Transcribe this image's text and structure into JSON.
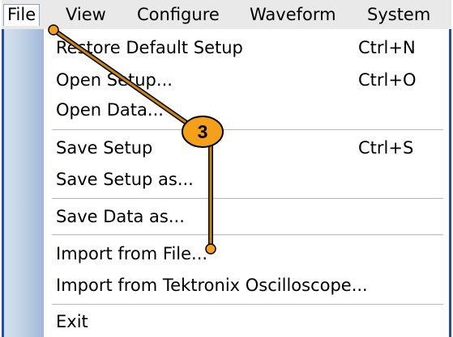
{
  "menubar": {
    "items": [
      "File",
      "View",
      "Configure",
      "Waveform",
      "System"
    ],
    "active_index": 0
  },
  "file_menu": {
    "items": [
      {
        "label": "Restore Default Setup",
        "shortcut": "Ctrl+N"
      },
      {
        "label": "Open Setup...",
        "shortcut": "Ctrl+O"
      },
      {
        "label": "Open Data...",
        "shortcut": ""
      },
      {
        "label": "Save Setup",
        "shortcut": "Ctrl+S"
      },
      {
        "label": "Save Setup as...",
        "shortcut": ""
      },
      {
        "label": "Save Data as...",
        "shortcut": ""
      },
      {
        "label": "Import from File...",
        "shortcut": ""
      },
      {
        "label": "Import from Tektronix Oscilloscope...",
        "shortcut": ""
      },
      {
        "label": "Exit",
        "shortcut": ""
      }
    ]
  },
  "callout": {
    "number": "3",
    "color": "#f5a019",
    "line_color": "#c8860e"
  }
}
